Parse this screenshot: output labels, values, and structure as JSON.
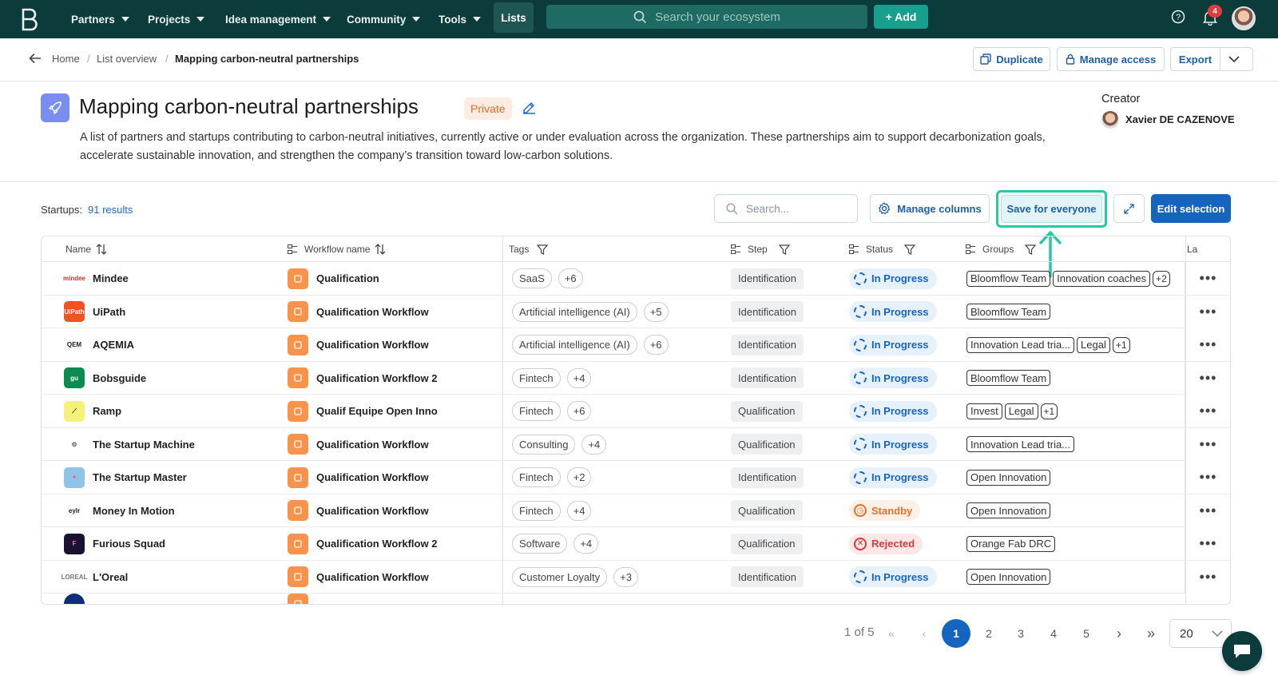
{
  "nav": {
    "items": [
      {
        "label": "Partners"
      },
      {
        "label": "Projects"
      },
      {
        "label": "Idea management"
      },
      {
        "label": "Community"
      },
      {
        "label": "Tools"
      }
    ],
    "lists_label": "Lists",
    "search_placeholder": "Search your ecosystem",
    "add_label": "+ Add",
    "notification_count": "4"
  },
  "breadcrumb": {
    "home": "Home",
    "overview": "List overview",
    "current": "Mapping carbon-neutral partnerships"
  },
  "actions": {
    "duplicate": "Duplicate",
    "manage_access": "Manage access",
    "export": "Export"
  },
  "header": {
    "title": "Mapping carbon-neutral partnerships",
    "visibility": "Private",
    "description": "A list of partners and startups contributing to carbon-neutral initiatives, currently active or under evaluation across the organization. These partnerships aim to support decarbonization goals, accelerate sustainable innovation, and strengthen the company’s transition toward low-carbon solutions.",
    "creator_label": "Creator",
    "creator_name": "Xavier DE CAZENOVE"
  },
  "toolbar": {
    "results_label": "Startups:",
    "results_count": "91 results",
    "search_placeholder": "Search...",
    "manage_columns": "Manage columns",
    "save_for_everyone": "Save for everyone",
    "edit_selection": "Edit selection"
  },
  "table": {
    "headers": {
      "name": "Name",
      "workflow": "Workflow name",
      "tags": "Tags",
      "step": "Step",
      "status": "Status",
      "groups": "Groups",
      "last": "La"
    },
    "rows": [
      {
        "name": "Mindee",
        "logo_color": "#ffffff",
        "logo_text": "mindee",
        "logo_fg": "#d9332b",
        "workflow": "Qualification",
        "tag": "SaaS",
        "tag_more": "+6",
        "step": "Identification",
        "status": "In Progress",
        "status_kind": "progress",
        "groups": [
          "Bloomflow Team",
          "Innovation coaches"
        ],
        "groups_more": "+2"
      },
      {
        "name": "UiPath",
        "logo_color": "#f2531f",
        "logo_text": "UiPath",
        "logo_fg": "#ffffff",
        "workflow": "Qualification Workflow",
        "tag": "Artificial intelligence (AI)",
        "tag_more": "+5",
        "step": "Identification",
        "status": "In Progress",
        "status_kind": "progress",
        "groups": [
          "Bloomflow Team"
        ],
        "groups_more": ""
      },
      {
        "name": "AQEMIA",
        "logo_color": "#ffffff",
        "logo_text": "QEM",
        "logo_fg": "#222222",
        "workflow": "Qualification Workflow",
        "tag": "Artificial intelligence (AI)",
        "tag_more": "+6",
        "step": "Identification",
        "status": "In Progress",
        "status_kind": "progress",
        "groups": [
          "Innovation Lead tria...",
          "Legal"
        ],
        "groups_more": "+1"
      },
      {
        "name": "Bobsguide",
        "logo_color": "#0d8a52",
        "logo_text": "gu",
        "logo_fg": "#ffffff",
        "workflow": "Qualification Workflow 2",
        "tag": "Fintech",
        "tag_more": "+4",
        "step": "Identification",
        "status": "In Progress",
        "status_kind": "progress",
        "groups": [
          "Bloomflow Team"
        ],
        "groups_more": ""
      },
      {
        "name": "Ramp",
        "logo_color": "#f5f27a",
        "logo_text": "⟋",
        "logo_fg": "#222222",
        "workflow": "Qualif Equipe Open Inno",
        "tag": "Fintech",
        "tag_more": "+6",
        "step": "Qualification",
        "status": "In Progress",
        "status_kind": "progress",
        "groups": [
          "Invest",
          "Legal"
        ],
        "groups_more": "+1"
      },
      {
        "name": "The Startup Machine",
        "logo_color": "#ffffff",
        "logo_text": "⚙",
        "logo_fg": "#222222",
        "workflow": "Qualification Workflow",
        "tag": "Consulting",
        "tag_more": "+4",
        "step": "Qualification",
        "status": "In Progress",
        "status_kind": "progress",
        "groups": [
          "Innovation Lead tria..."
        ],
        "groups_more": ""
      },
      {
        "name": "The Startup Master",
        "logo_color": "#8fc3ea",
        "logo_text": "✦",
        "logo_fg": "#e05a8a",
        "workflow": "Qualification Workflow",
        "tag": "Fintech",
        "tag_more": "+2",
        "step": "Identification",
        "status": "In Progress",
        "status_kind": "progress",
        "groups": [
          "Open Innovation"
        ],
        "groups_more": ""
      },
      {
        "name": "Money In Motion",
        "logo_color": "#ffffff",
        "logo_text": "eylr",
        "logo_fg": "#222222",
        "workflow": "Qualification Workflow",
        "tag": "Fintech",
        "tag_more": "+4",
        "step": "Qualification",
        "status": "Standby",
        "status_kind": "standby",
        "groups": [
          "Open Innovation"
        ],
        "groups_more": ""
      },
      {
        "name": "Furious Squad",
        "logo_color": "#1a1230",
        "logo_text": "F",
        "logo_fg": "#ff5ea8",
        "workflow": "Qualification Workflow 2",
        "tag": "Software",
        "tag_more": "+4",
        "step": "Qualification",
        "status": "Rejected",
        "status_kind": "rejected",
        "groups": [
          "Orange Fab DRC"
        ],
        "groups_more": ""
      },
      {
        "name": "L'Oreal",
        "logo_color": "#ffffff",
        "logo_text": "LOREAL",
        "logo_fg": "#777777",
        "workflow": "Qualification Workflow",
        "tag": "Customer Loyalty",
        "tag_more": "+3",
        "step": "Identification",
        "status": "In Progress",
        "status_kind": "progress",
        "groups": [
          "Open Innovation"
        ],
        "groups_more": ""
      }
    ]
  },
  "pagination": {
    "summary": "1 of 5",
    "pages": [
      "1",
      "2",
      "3",
      "4",
      "5"
    ],
    "current": "1",
    "page_size": "20"
  },
  "colors": {
    "nav_bg": "#0b3b3a",
    "accent": "#1565c0",
    "highlight": "#2ac7a6"
  }
}
